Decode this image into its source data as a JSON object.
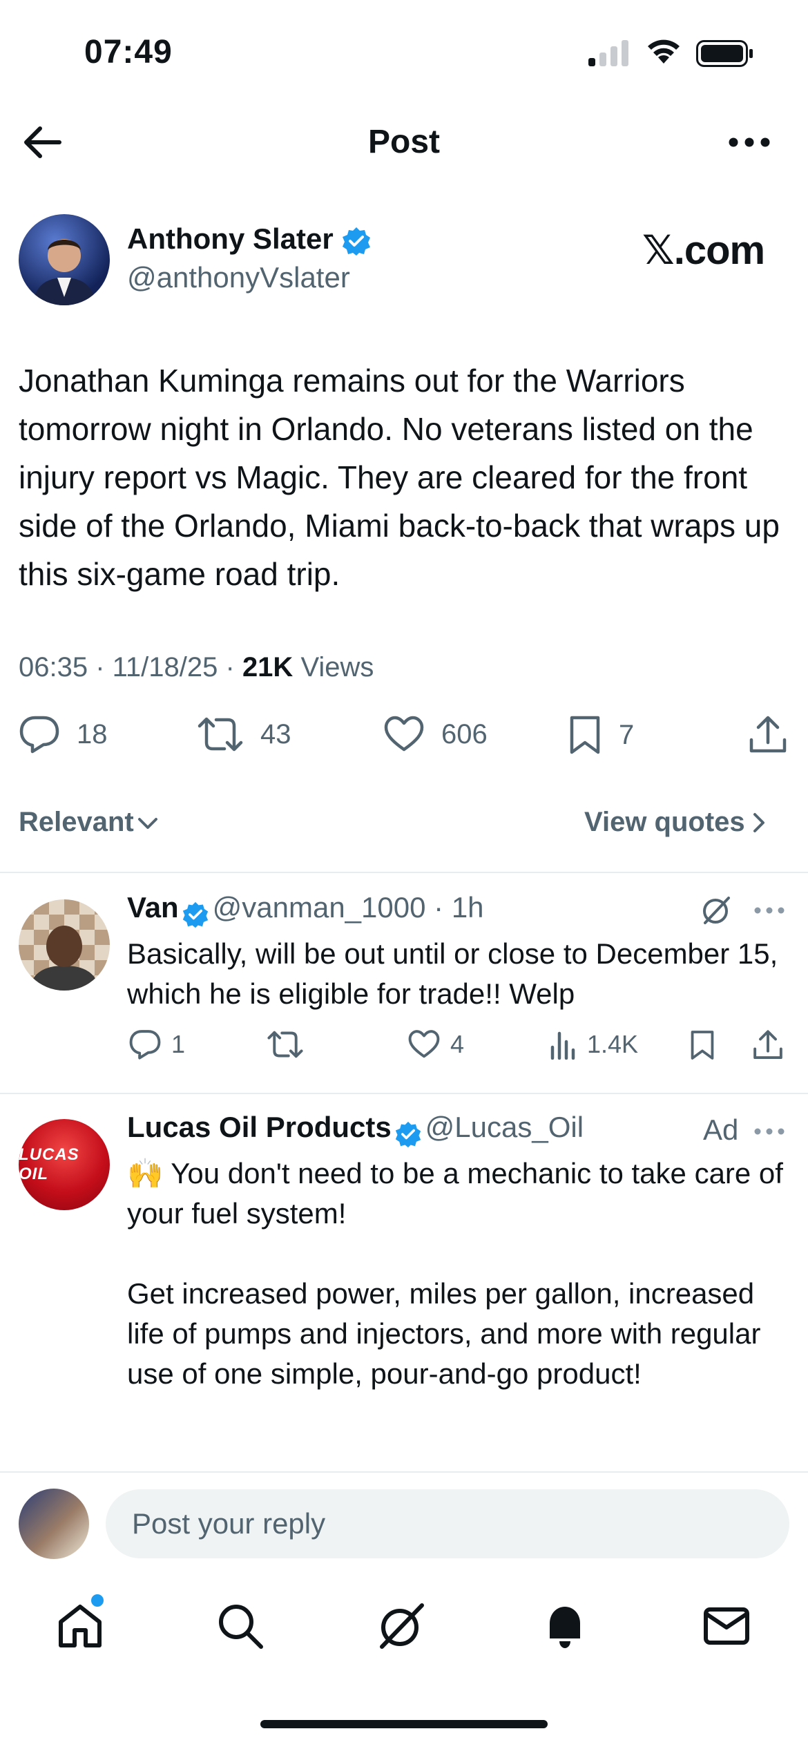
{
  "status_bar": {
    "time": "07:49"
  },
  "header": {
    "title": "Post"
  },
  "post": {
    "author_name": "Anthony Slater",
    "author_handle": "@anthonyVslater",
    "source": "𝕏.com",
    "text": "Jonathan Kuminga remains out for the Warriors tomorrow night in Orlando. No veterans listed on the injury report vs Magic. They are cleared for the front side of the Orlando, Miami back-to-back that wraps up this six-game road trip.",
    "time": "06:35",
    "date": "11/18/25",
    "views_count": "21K",
    "views_label": "Views",
    "replies": "18",
    "reposts": "43",
    "likes": "606",
    "bookmarks": "7"
  },
  "filters": {
    "sort": "Relevant",
    "view_quotes": "View quotes"
  },
  "reply": {
    "name": "Van",
    "handle": "@vanman_1000",
    "age": "1h",
    "text": "Basically, will be out until or close to December 15, which he is eligible for trade!!  Welp",
    "replies": "1",
    "likes": "4",
    "views": "1.4K"
  },
  "ad": {
    "name": "Lucas Oil Products",
    "handle": "@Lucas_Oil",
    "label": "Ad",
    "logo_text": "LUCAS OIL",
    "text_line1": "🙌 You don't need to be a mechanic to take care of your fuel system!",
    "text_line2": "Get increased power, miles per gallon, increased life of pumps and injectors, and more with regular use of one simple, pour-and-go product!"
  },
  "composer": {
    "placeholder": "Post your reply"
  },
  "colors": {
    "accent": "#1d9bf0",
    "text": "#0f1419",
    "secondary": "#536471"
  }
}
